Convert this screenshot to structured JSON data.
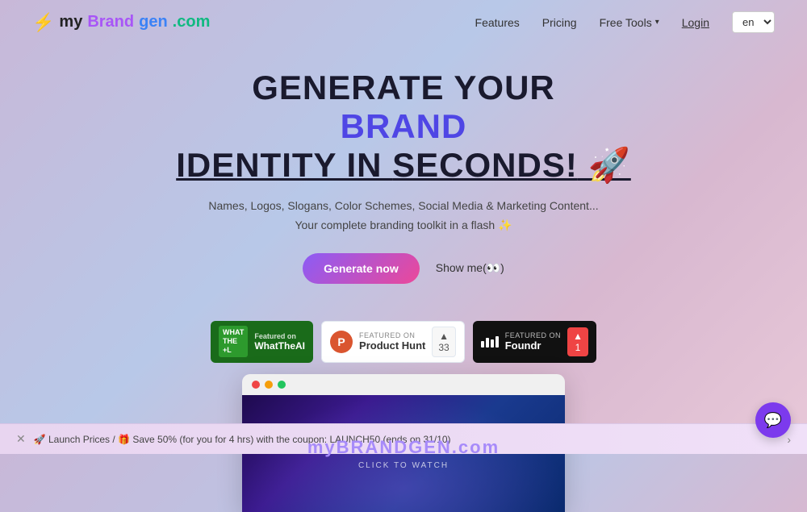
{
  "logo": {
    "icon": "⚡",
    "my": "my",
    "brand": "Brand",
    "gen": "gen",
    "com": ".com"
  },
  "nav": {
    "features": "Features",
    "pricing": "Pricing",
    "freeTools": "Free Tools",
    "login": "Login",
    "lang": "en"
  },
  "hero": {
    "line1": "GENERATE YOUR",
    "line2": "BRAND",
    "line3_prefix": "IDENTITY IN ",
    "line3_underline": "SECONDS!",
    "line3_emoji": " 🚀",
    "sub1": "Names, Logos, Slogans, Color Schemes, Social Media & Marketing Content...",
    "sub2": "Your complete branding toolkit in a flash ✨",
    "btn_generate": "Generate now",
    "btn_show": "Show me(👀)"
  },
  "badges": {
    "whattheai": {
      "featured_on": "Featured on",
      "name": "WhatTheAI"
    },
    "producthunt": {
      "featured_on": "FEATURED ON",
      "name": "Product Hunt",
      "logo_letter": "P",
      "count": "▲",
      "count_num": "33"
    },
    "foundr": {
      "featured_on": "FEATURED ON",
      "name": "Foundr",
      "count_num": "1"
    }
  },
  "video": {
    "brand_my": "my",
    "brand_name": "BRANDGEN",
    "brand_com": ".com",
    "click_text": "CLICK TO WATCH"
  },
  "banner": {
    "text": "🚀 Launch Prices / 🎁 Save 50% (for you for 4 hrs) with the coupon: LAUNCH50 (ends on 31/10)"
  },
  "chat": {
    "icon": "💬"
  }
}
